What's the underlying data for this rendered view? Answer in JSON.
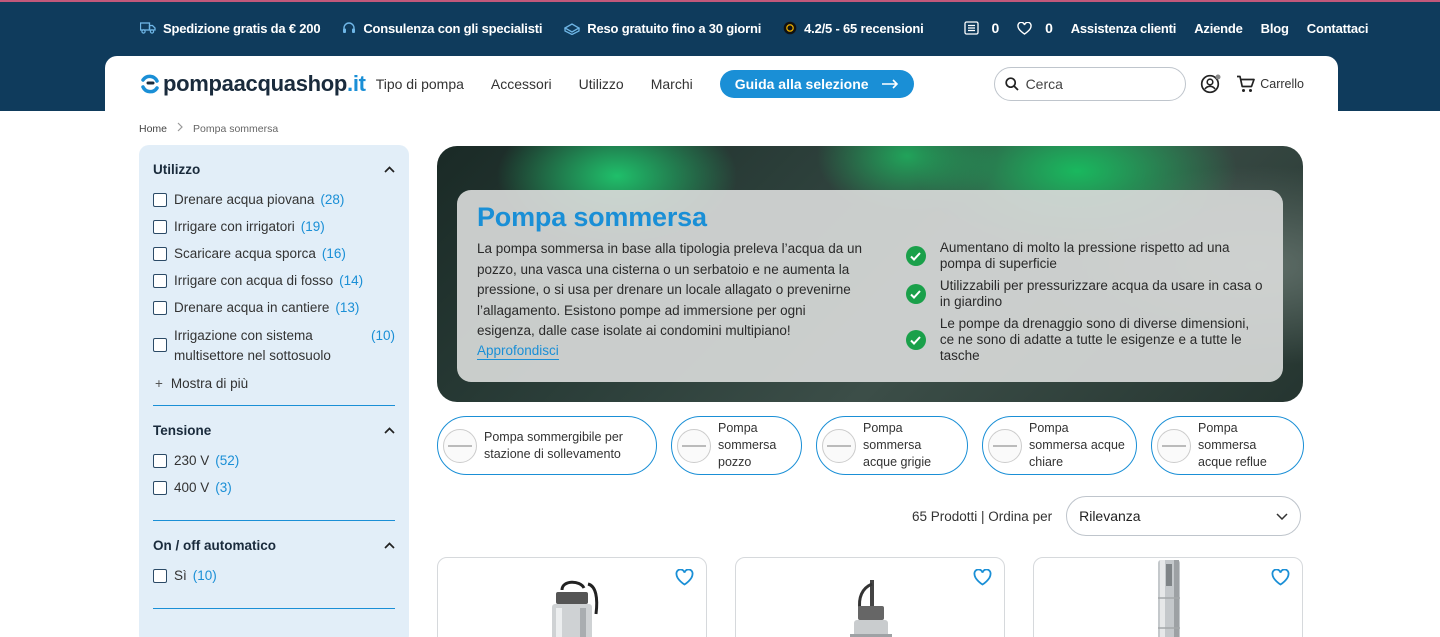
{
  "topbar": {
    "shipping": "Spedizione gratis da € 200",
    "consulting": "Consulenza con gli specialisti",
    "returns": "Reso gratuito fino a 30 giorni",
    "reviews": "4.2/5 - 65 recensioni",
    "compare_count": "0",
    "wishlist_count": "0",
    "customer_service": "Assistenza clienti",
    "business": "Aziende",
    "blog": "Blog",
    "contacts": "Contattaci"
  },
  "header": {
    "logo_main": "pompaacquashop",
    "logo_tld": ".it",
    "nav": [
      "Tipo di pompa",
      "Accessori",
      "Utilizzo",
      "Marchi"
    ],
    "guide_button": "Guida alla selezione",
    "search_placeholder": "Cerca",
    "cart_label": "Carrello"
  },
  "breadcrumb": {
    "home": "Home",
    "current": "Pompa sommersa"
  },
  "filters": [
    {
      "title": "Utilizzo",
      "options": [
        {
          "label": "Drenare acqua piovana",
          "count": "(28)"
        },
        {
          "label": "Irrigare con irrigatori",
          "count": "(19)"
        },
        {
          "label": "Scaricare acqua sporca",
          "count": "(16)"
        },
        {
          "label": "Irrigare con acqua di fosso",
          "count": "(14)"
        },
        {
          "label": "Drenare acqua in cantiere",
          "count": "(13)"
        },
        {
          "label": "Irrigazione con sistema multisettore nel sottosuolo",
          "count": "(10)"
        }
      ],
      "show_more": "Mostra di più"
    },
    {
      "title": "Tensione",
      "options": [
        {
          "label": "230 V",
          "count": "(52)"
        },
        {
          "label": "400 V",
          "count": "(3)"
        }
      ]
    },
    {
      "title": "On / off automatico",
      "options": [
        {
          "label": "Sì",
          "count": "(10)"
        }
      ]
    }
  ],
  "hero": {
    "title": "Pompa sommersa",
    "text": "La pompa sommersa in base alla tipologia preleva l’acqua da un pozzo, una vasca una cisterna o un serbatoio e ne aumenta la pressione, o si usa per drenare un locale allagato o prevenirne l’allagamento. Esistono pompe ad immersione per ogni esigenza, dalle case isolate ai condomini multipiano!",
    "link": "Approfondisci",
    "bullets": [
      "Aumentano di molto la pressione rispetto ad una pompa di superficie",
      "Utilizzabili per pressurizzare acqua da usare in casa o in giardino",
      "Le pompe da drenaggio sono di diverse dimensioni, ce ne sono di adatte a tutte le esigenze e a tutte le tasche"
    ]
  },
  "subcategories": [
    "Pompa sommergibile per stazione di sollevamento",
    "Pompa sommersa pozzo",
    "Pompa sommersa acque grigie",
    "Pompa sommersa acque chiare",
    "Pompa sommersa acque reflue"
  ],
  "listing": {
    "count_text": "65 Prodotti | Ordina per",
    "sort_value": "Rilevanza"
  },
  "colors": {
    "navy": "#0f3b5c",
    "accent": "#1a8fd6",
    "check_green": "#1aa04a",
    "sidebar_bg": "#e2eef8"
  }
}
